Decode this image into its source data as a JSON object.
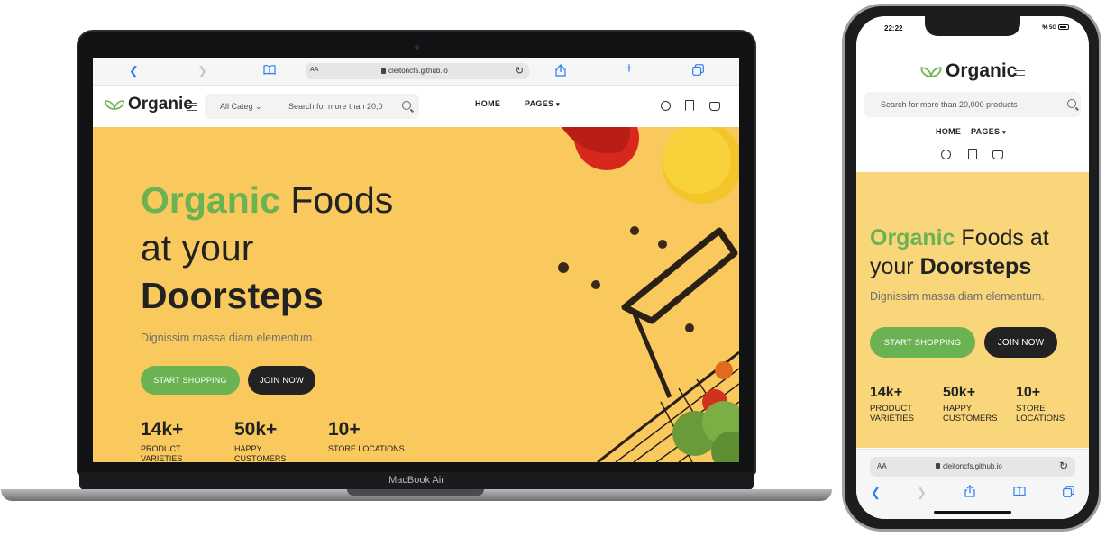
{
  "site": {
    "logo_text": "Organic",
    "brand_green": "#6bb252",
    "hero_bg": "#f9c95e",
    "dark_button": "#222222"
  },
  "browser": {
    "url": "cleitoncfs.github.io",
    "aa": "AA",
    "laptop_toolbar_icons": [
      "back-icon",
      "forward-icon",
      "bookmarks-icon",
      "reload-icon",
      "share-icon",
      "new-tab-icon",
      "tabs-icon"
    ]
  },
  "laptop": {
    "brand_label": "MacBook Air",
    "search": {
      "category": "All Categ",
      "placeholder": "Search for more than 20,0"
    },
    "nav": {
      "home": "HOME",
      "pages": "PAGES"
    },
    "hero": {
      "title_green": "Organic",
      "title_rest_line1": " Foods",
      "title_line2": "at your",
      "title_line3": "Doorsteps",
      "subtitle": "Dignissim massa diam elementum.",
      "btn_primary": "START SHOPPING",
      "btn_secondary": "JOIN NOW"
    },
    "stats": [
      {
        "number": "14k+",
        "label_1": "PRODUCT",
        "label_2": "VARIETIES"
      },
      {
        "number": "50k+",
        "label_1": "HAPPY",
        "label_2": "CUSTOMERS"
      },
      {
        "number": "10+",
        "label_1": "STORE LOCATIONS",
        "label_2": ""
      }
    ]
  },
  "phone": {
    "time": "22:22",
    "signal": "5G",
    "search_placeholder": "Search for more than 20,000 products",
    "nav": {
      "home": "HOME",
      "pages": "PAGES"
    },
    "hero": {
      "title_green": "Organic",
      "title_rest_line1": " Foods at",
      "title_line2_pre": "your ",
      "title_line2_bold": "Doorsteps",
      "subtitle": "Dignissim massa diam elementum.",
      "btn_primary": "START SHOPPING",
      "btn_secondary": "JOIN NOW"
    },
    "stats": [
      {
        "number": "14k+",
        "label_1": "PRODUCT",
        "label_2": "VARIETIES"
      },
      {
        "number": "50k+",
        "label_1": "HAPPY",
        "label_2": "CUSTOMERS"
      },
      {
        "number": "10+",
        "label_1": "STORE",
        "label_2": "LOCATIONS"
      }
    ]
  }
}
